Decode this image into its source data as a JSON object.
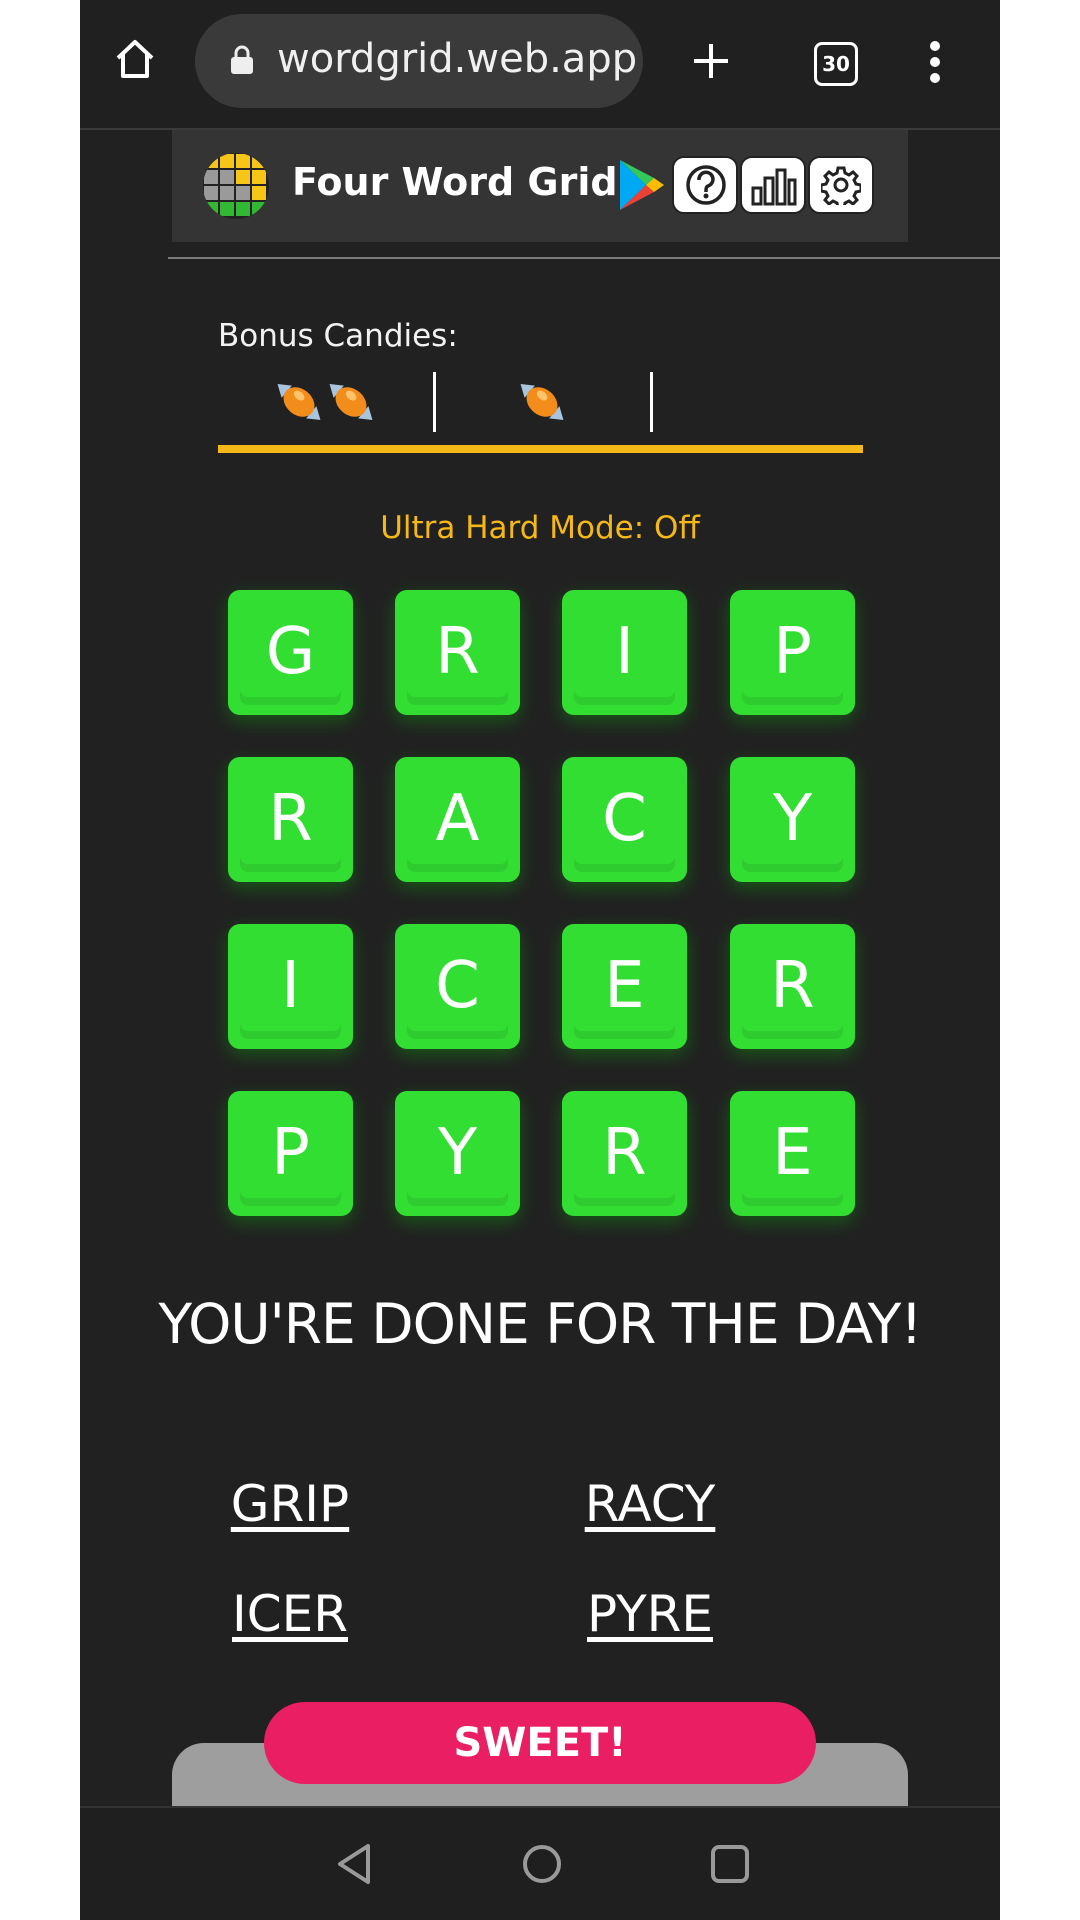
{
  "browser": {
    "url": "wordgrid.web.app",
    "tab_count": "30",
    "home_icon": "home-icon",
    "lock_icon": "lock-icon",
    "new_tab_icon": "plus-icon",
    "menu_icon": "kebab-menu-icon"
  },
  "header": {
    "title": "Four Word Grid",
    "logo_icon": "grid-logo-icon",
    "play_store_icon": "google-play-icon",
    "help_icon": "question-icon",
    "stats_icon": "bar-chart-icon",
    "settings_icon": "gear-icon"
  },
  "bonus": {
    "label": "Bonus Candies:",
    "candies_slot1": 2,
    "candies_slot2": 1,
    "candies_slot3": 0,
    "candy_icon": "candy-icon",
    "track_color": "#f5b818"
  },
  "mode": {
    "label": "Ultra Hard Mode: Off"
  },
  "grid": {
    "rows": [
      [
        "G",
        "R",
        "I",
        "P"
      ],
      [
        "R",
        "A",
        "C",
        "Y"
      ],
      [
        "I",
        "C",
        "E",
        "R"
      ],
      [
        "P",
        "Y",
        "R",
        "E"
      ]
    ],
    "tile_color": "#33de33"
  },
  "result": {
    "message": "YOU'RE DONE FOR THE DAY!"
  },
  "words": [
    "GRIP",
    "RACY",
    "ICER",
    "PYRE"
  ],
  "sweet_button": {
    "label": "SWEET!",
    "color": "#e91e63"
  },
  "nav": {
    "back_icon": "back-triangle-icon",
    "home_icon": "home-circle-icon",
    "recents_icon": "recents-square-icon"
  }
}
